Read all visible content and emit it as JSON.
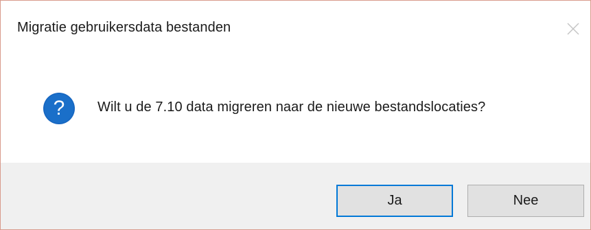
{
  "window": {
    "title": "Migratie gebruikersdata bestanden",
    "close_icon": "close-icon"
  },
  "message": {
    "icon": "question-icon",
    "icon_color": "#1565c0",
    "text": "Wilt u de 7.10 data migreren naar de nieuwe bestandslocaties?"
  },
  "buttons": {
    "yes_label": "Ja",
    "no_label": "Nee",
    "default": "Ja",
    "accent_color": "#0078d7"
  }
}
